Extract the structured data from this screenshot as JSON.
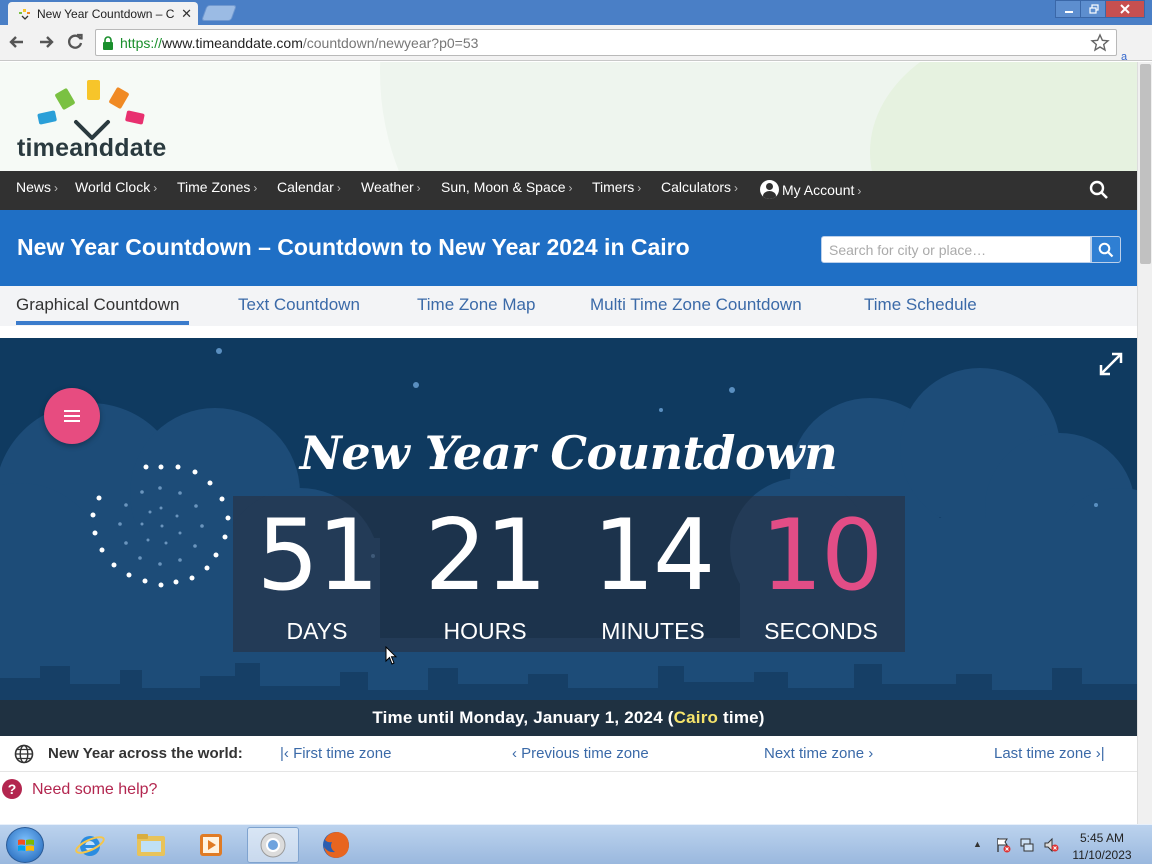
{
  "browser": {
    "tab_title": "New Year Countdown – C",
    "tab_close": "✕",
    "url_secure": "https://",
    "url_host": "www.timeanddate.com",
    "url_path": "/countdown/newyear?p0=53",
    "extension_label": "a"
  },
  "site": {
    "logo_text": "timeanddate",
    "nav": [
      {
        "label": "News"
      },
      {
        "label": "World Clock"
      },
      {
        "label": "Time Zones"
      },
      {
        "label": "Calendar"
      },
      {
        "label": "Weather"
      },
      {
        "label": "Sun, Moon & Space"
      },
      {
        "label": "Timers"
      },
      {
        "label": "Calculators"
      },
      {
        "label": "My Account"
      }
    ],
    "page_title": "New Year Countdown – Countdown to New Year 2024 in Cairo",
    "search_placeholder": "Search for city or place…",
    "subtabs": [
      {
        "label": "Graphical Countdown"
      },
      {
        "label": "Text Countdown"
      },
      {
        "label": "Time Zone Map"
      },
      {
        "label": "Multi Time Zone Countdown"
      },
      {
        "label": "Time Schedule"
      }
    ]
  },
  "countdown": {
    "heading": "New Year Countdown",
    "units": [
      {
        "value": "51",
        "label": "DAYS"
      },
      {
        "value": "21",
        "label": "HOURS"
      },
      {
        "value": "14",
        "label": "MINUTES"
      },
      {
        "value": "10",
        "label": "SECONDS"
      }
    ],
    "footer_prefix": "Time until Monday, January 1, 2024 (",
    "footer_city": "Cairo",
    "footer_suffix": " time)",
    "seconds_color": "#e24d86"
  },
  "world": {
    "label": "New Year across the world:",
    "first": "First time zone",
    "previous": "Previous time zone",
    "next": "Next time zone",
    "last": "Last time zone"
  },
  "help": {
    "icon": "?",
    "link": "Need some help?"
  },
  "taskbar": {
    "time": "5:45 AM",
    "date": "11/10/2023"
  },
  "colors": {
    "accent_blue": "#1f6fc5",
    "nav_dark": "#313131",
    "countdown_bg": "#0f3a60",
    "pink": "#e74c80",
    "link": "#3b6aa8"
  }
}
